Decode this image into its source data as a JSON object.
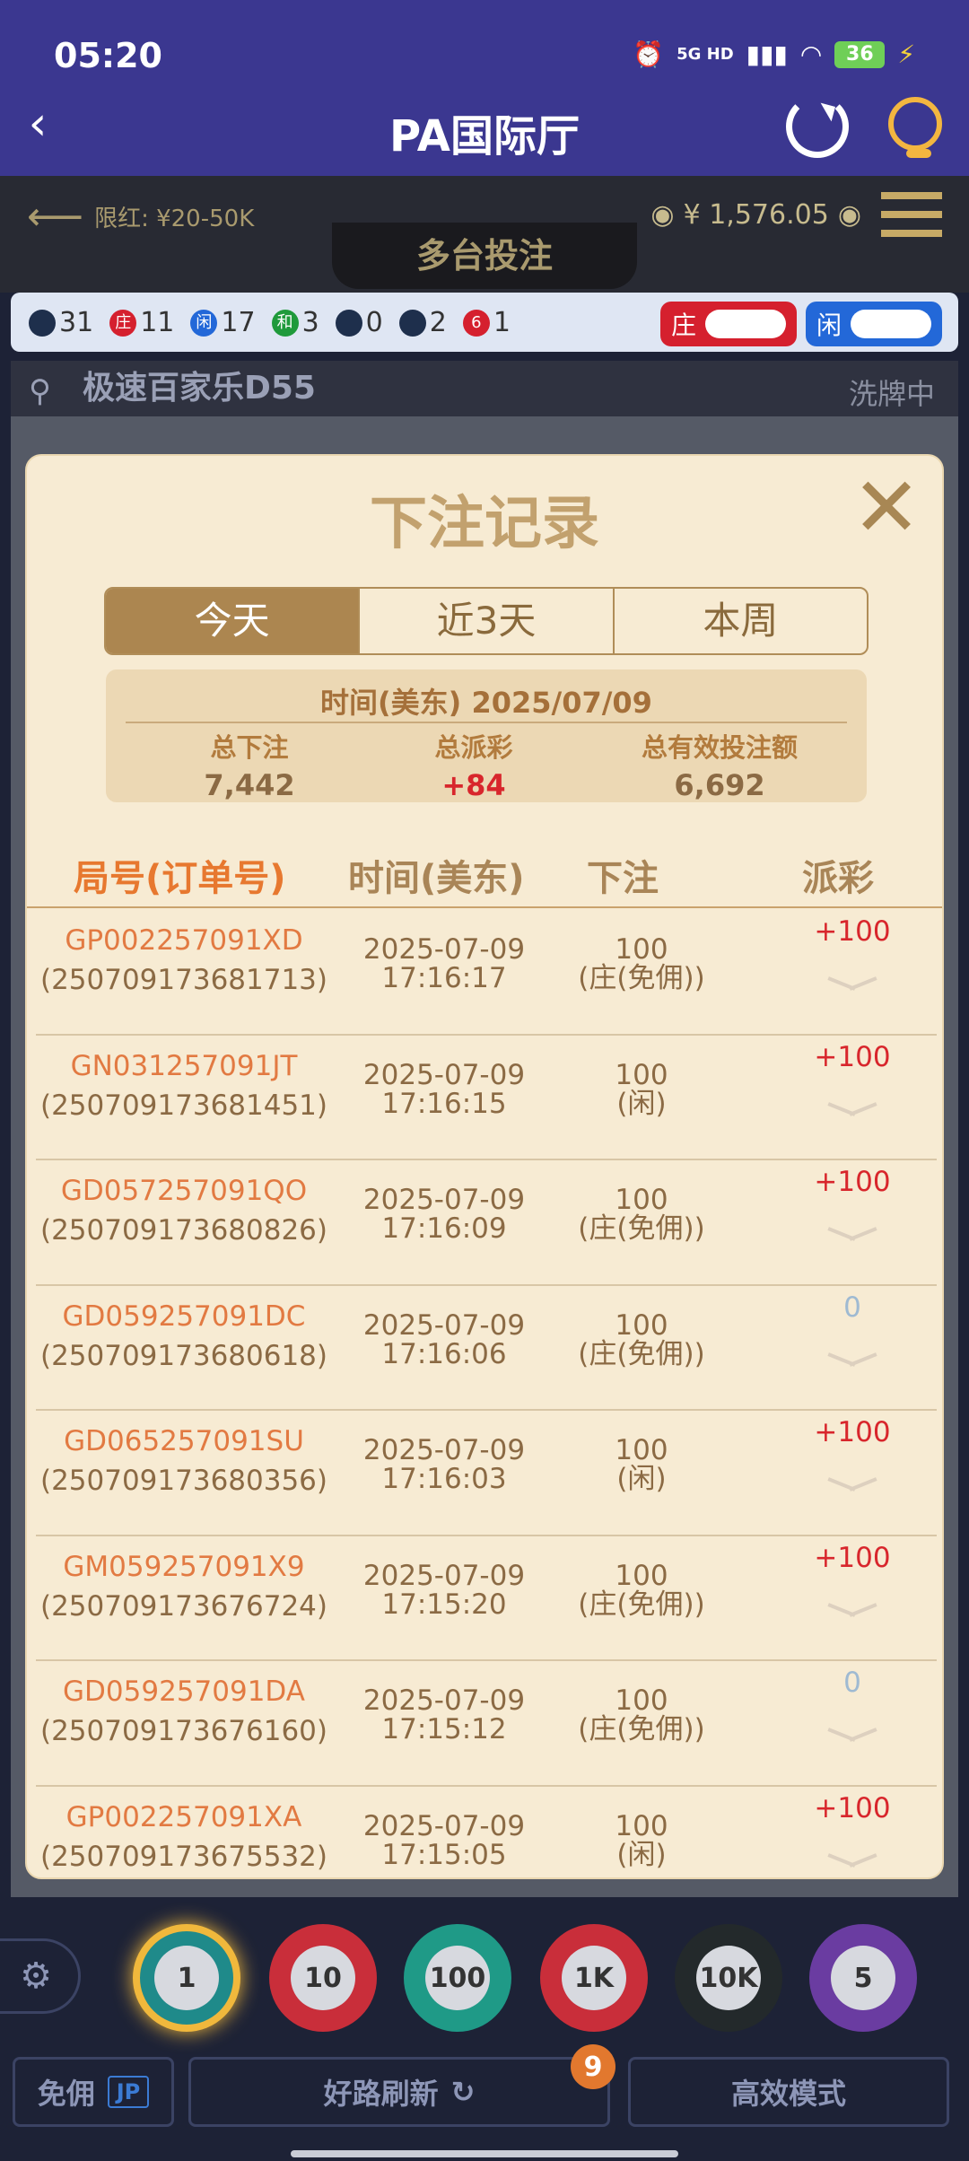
{
  "status_bar": {
    "time": "05:20",
    "battery": "36",
    "network": "5G HD"
  },
  "header": {
    "title": "PA国际厅"
  },
  "game": {
    "limit": "限红: ¥20-50K",
    "balance": "¥ 1,576.05",
    "mode_tab": "多台投注",
    "road": [
      {
        "label": "31",
        "color": "#1e2f4c"
      },
      {
        "label": "庄",
        "count": "11",
        "color": "#d5202e"
      },
      {
        "label": "闲",
        "count": "17",
        "color": "#2368d8"
      },
      {
        "label": "和",
        "count": "3",
        "color": "#1f9a3b"
      },
      {
        "label": "",
        "count": "0",
        "color": "#1e2f4c"
      },
      {
        "label": "",
        "count": "2",
        "color": "#1e2f4c"
      },
      {
        "label": "6",
        "count": "1",
        "color": "#d5202e"
      }
    ],
    "toggle_banker": "庄",
    "toggle_player": "闲",
    "table_name": "极速百家乐D55",
    "table_status": "洗牌中"
  },
  "modal": {
    "title": "下注记录",
    "tabs": [
      "今天",
      "近3天",
      "本周"
    ],
    "summary": {
      "date": "时间(美东) 2025/07/09",
      "total_bet_label": "总下注",
      "total_bet": "7,442",
      "total_payout_label": "总派彩",
      "total_payout": "+84",
      "valid_bet_label": "总有效投注额",
      "valid_bet": "6,692"
    },
    "columns": [
      "局号(订单号)",
      "时间(美东)",
      "下注",
      "派彩"
    ],
    "rows": [
      {
        "id": "GP002257091XD",
        "order": "(250709173681713)",
        "date": "2025-07-09",
        "time": "17:16:17",
        "amount": "100",
        "bet": "(庄(免佣))",
        "payout": "+100"
      },
      {
        "id": "GN031257091JT",
        "order": "(250709173681451)",
        "date": "2025-07-09",
        "time": "17:16:15",
        "amount": "100",
        "bet": "(闲)",
        "payout": "+100"
      },
      {
        "id": "GD057257091QO",
        "order": "(250709173680826)",
        "date": "2025-07-09",
        "time": "17:16:09",
        "amount": "100",
        "bet": "(庄(免佣))",
        "payout": "+100"
      },
      {
        "id": "GD059257091DC",
        "order": "(250709173680618)",
        "date": "2025-07-09",
        "time": "17:16:06",
        "amount": "100",
        "bet": "(庄(免佣))",
        "payout": "0"
      },
      {
        "id": "GD065257091SU",
        "order": "(250709173680356)",
        "date": "2025-07-09",
        "time": "17:16:03",
        "amount": "100",
        "bet": "(闲)",
        "payout": "+100"
      },
      {
        "id": "GM059257091X9",
        "order": "(250709173676724)",
        "date": "2025-07-09",
        "time": "17:15:20",
        "amount": "100",
        "bet": "(庄(免佣))",
        "payout": "+100"
      },
      {
        "id": "GD059257091DA",
        "order": "(250709173676160)",
        "date": "2025-07-09",
        "time": "17:15:12",
        "amount": "100",
        "bet": "(庄(免佣))",
        "payout": "0"
      },
      {
        "id": "GP002257091XA",
        "order": "(250709173675532)",
        "date": "2025-07-09",
        "time": "17:15:05",
        "amount": "100",
        "bet": "(闲)",
        "payout": "+100"
      }
    ]
  },
  "bottom": {
    "chips": [
      "1",
      "10",
      "100",
      "1K",
      "10K",
      "5"
    ],
    "free_label": "免佣",
    "jp_label": "JP",
    "refresh_label": "好路刷新",
    "refresh_badge": "9",
    "mode_label": "高效模式"
  }
}
